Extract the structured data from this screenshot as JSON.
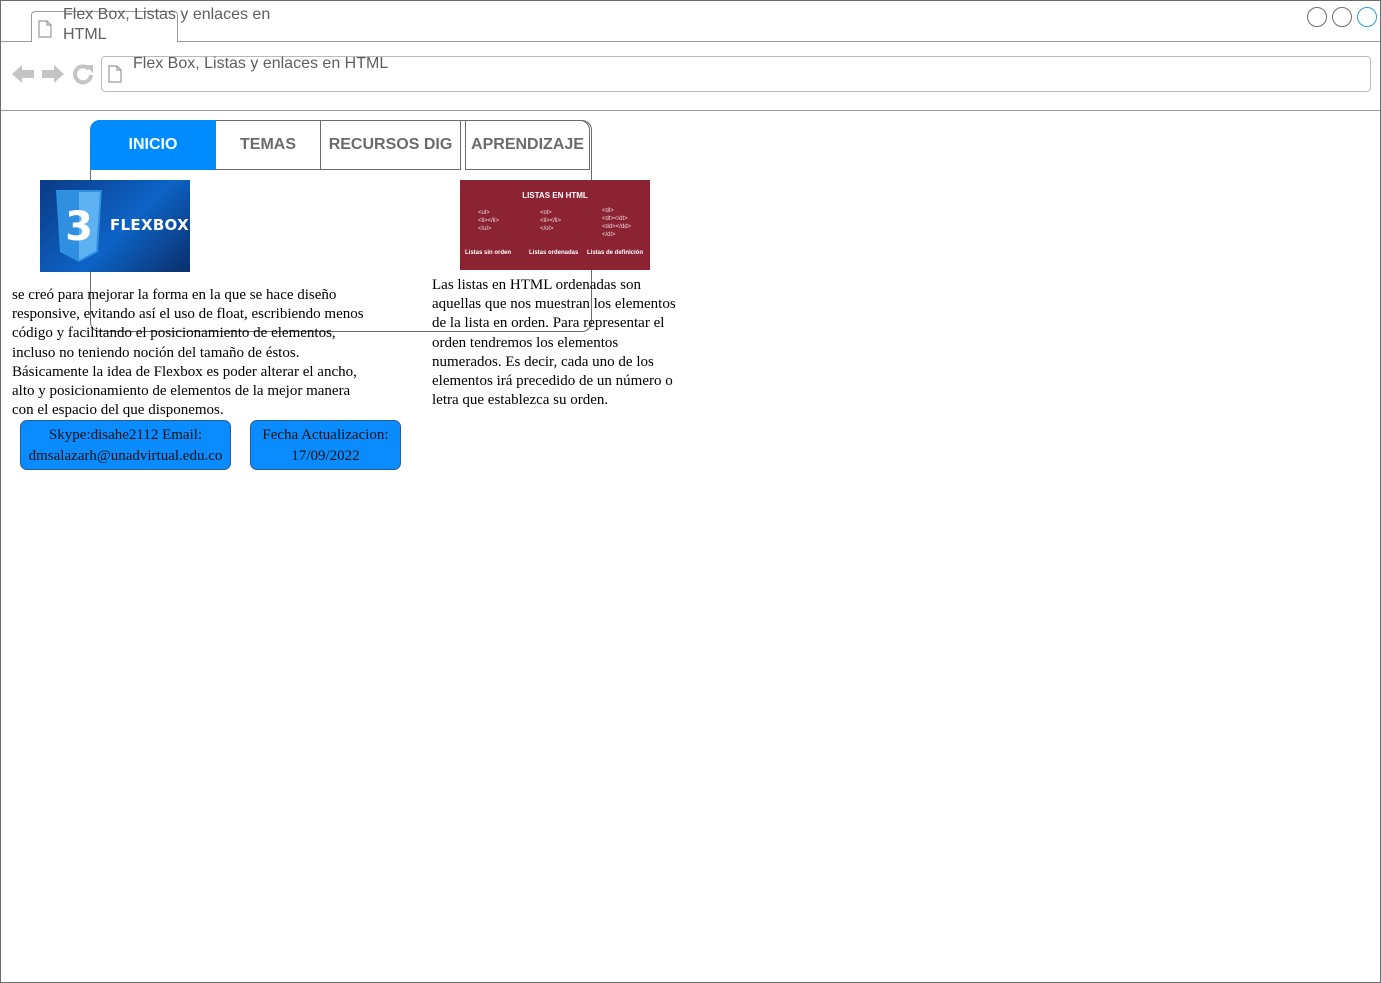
{
  "browser": {
    "tab_title": "Flex Box, Listas y enlaces en HTML",
    "address": "Flex Box, Listas y enlaces en HTML"
  },
  "menu": {
    "items": [
      {
        "label": "INICIO",
        "active": true
      },
      {
        "label": "TEMAS"
      },
      {
        "label": "RECURSOS DIG"
      },
      {
        "label": "APRENDIZAJE"
      }
    ]
  },
  "flexbox_image": {
    "logo_text": "FLEXBOX",
    "badge_number": "3"
  },
  "listas_image": {
    "title": "LISTAS EN HTML",
    "code_unordered": [
      "<ul>",
      "<li></li>",
      "</ul>"
    ],
    "code_ordered": [
      "<ol>",
      "<li></li>",
      "</ol>"
    ],
    "code_definition": [
      "<dl>",
      "<dt></dt>",
      "<dd></dd>",
      "</dl>"
    ],
    "caption_unordered": "Listas sin orden",
    "caption_ordered": "Listas ordenadas",
    "caption_definition": "Listas de definición"
  },
  "flexbox_text": "se creó para mejorar la forma en la que se hace diseño responsive, evitando así el uso de float, escribiendo menos código y facilitando el posicionamiento de elementos, incluso no teniendo noción del tamaño de éstos. Básicamente la idea de Flexbox es poder alterar el ancho, alto y posicionamiento de elementos de la mejor manera con el espacio del que disponemos.",
  "listas_text": "Las listas en HTML ordenadas son aquellas que nos muestran los elementos de la lista en orden. Para representar el orden tendremos los elementos numerados. Es decir, cada uno de los elementos irá precedido de un número o letra que establezca su orden.",
  "contact": {
    "line1": "Skype:disahe2112 Email:",
    "line2": "dmsalazarh@unadvirtual.edu.co"
  },
  "update": {
    "line1": "Fecha Actualizacion:",
    "line2": "17/09/2022"
  },
  "colors": {
    "accent": "#008cff",
    "listas_bg": "#8b2333"
  }
}
